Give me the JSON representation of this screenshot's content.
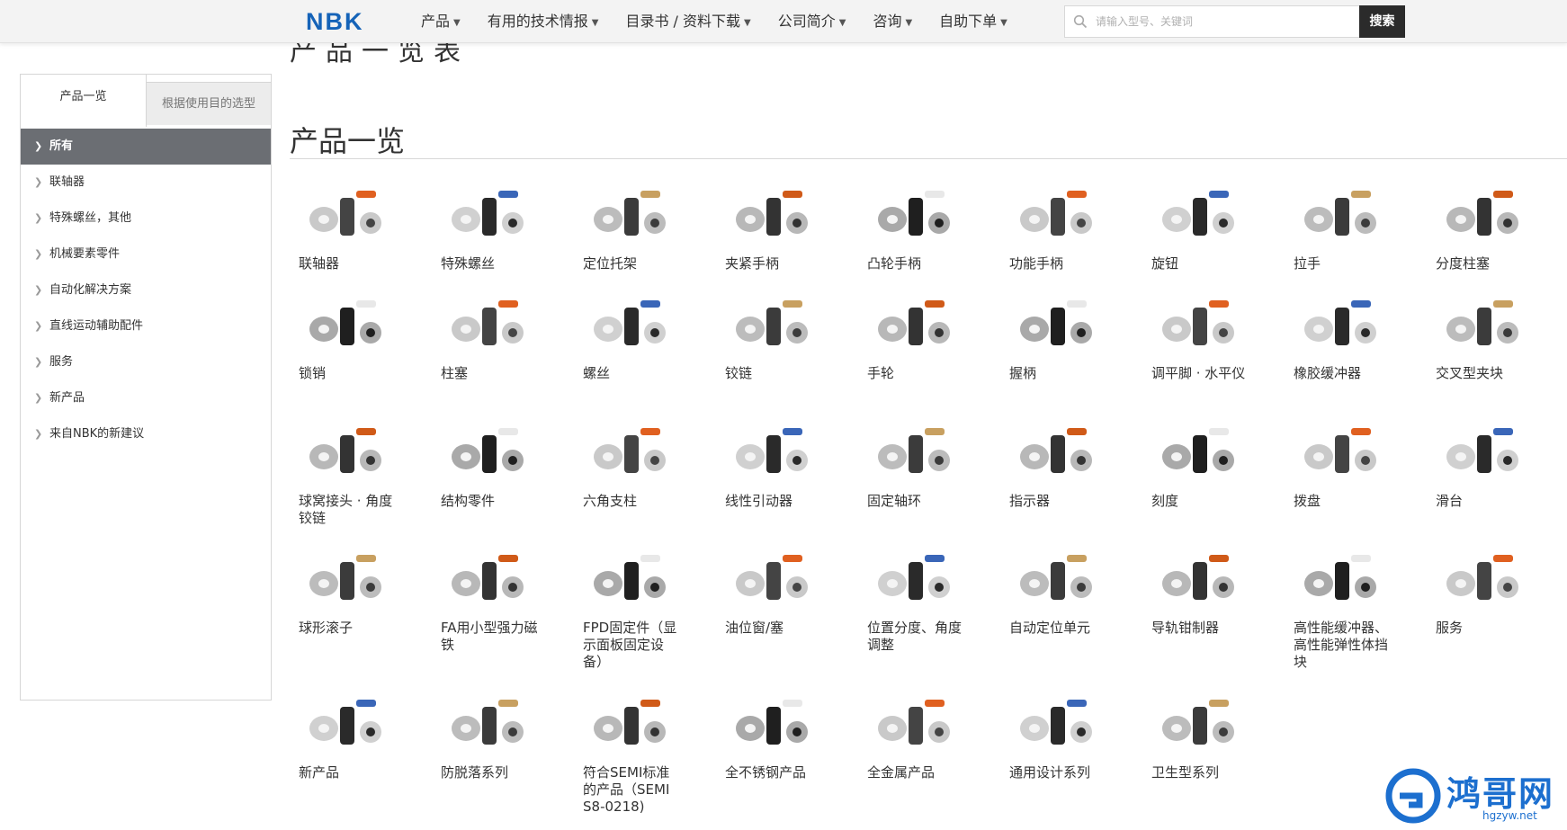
{
  "header": {
    "logo": "NBK",
    "nav": [
      {
        "label": "产品"
      },
      {
        "label": "有用的技术情报"
      },
      {
        "label": "目录书 / 资料下载"
      },
      {
        "label": "公司简介"
      },
      {
        "label": "咨询"
      },
      {
        "label": "自助下单"
      }
    ],
    "search_placeholder": "请输入型号、关键词",
    "search_button": "搜索"
  },
  "ghost_title": "产品一览表",
  "sidebar": {
    "tabs": [
      {
        "label": "产品一览",
        "active": true
      },
      {
        "label": "根据使用目的选型",
        "active": false
      }
    ],
    "items": [
      {
        "label": "所有",
        "active": true
      },
      {
        "label": "联轴器"
      },
      {
        "label": "特殊螺丝，其他"
      },
      {
        "label": "机械要素零件"
      },
      {
        "label": "自动化解决方案"
      },
      {
        "label": "直线运动辅助配件"
      },
      {
        "label": "服务"
      },
      {
        "label": "新产品"
      },
      {
        "label": "来自NBK的新建议"
      }
    ]
  },
  "main": {
    "title": "产品一览",
    "products": [
      {
        "label": "联轴器",
        "icon": "coupling-icon"
      },
      {
        "label": "特殊螺丝",
        "icon": "screw-icon"
      },
      {
        "label": "定位托架",
        "icon": "bracket-icon"
      },
      {
        "label": "夹紧手柄",
        "icon": "clamp-lever-icon"
      },
      {
        "label": "凸轮手柄",
        "icon": "cam-lever-icon"
      },
      {
        "label": "功能手柄",
        "icon": "function-handle-icon"
      },
      {
        "label": "旋钮",
        "icon": "knob-icon"
      },
      {
        "label": "拉手",
        "icon": "pull-handle-icon"
      },
      {
        "label": "分度柱塞",
        "icon": "indexing-plunger-icon"
      },
      {
        "label": "锁销",
        "icon": "lock-pin-icon"
      },
      {
        "label": "柱塞",
        "icon": "plunger-icon"
      },
      {
        "label": "螺丝",
        "icon": "bolt-icon"
      },
      {
        "label": "铰链",
        "icon": "hinge-icon"
      },
      {
        "label": "手轮",
        "icon": "handwheel-icon"
      },
      {
        "label": "握柄",
        "icon": "grip-icon"
      },
      {
        "label": "调平脚 · 水平仪",
        "icon": "leveling-foot-icon"
      },
      {
        "label": "橡胶缓冲器",
        "icon": "rubber-bumper-icon"
      },
      {
        "label": "交叉型夹块",
        "icon": "cross-clamp-icon"
      },
      {
        "label": "球窝接头 · 角度铰链",
        "icon": "ball-joint-icon"
      },
      {
        "label": "结构零件",
        "icon": "structure-part-icon"
      },
      {
        "label": "六角支柱",
        "icon": "hex-standoff-icon"
      },
      {
        "label": "线性引动器",
        "icon": "linear-actuator-icon"
      },
      {
        "label": "固定轴环",
        "icon": "shaft-collar-icon"
      },
      {
        "label": "指示器",
        "icon": "indicator-icon"
      },
      {
        "label": "刻度",
        "icon": "scale-icon"
      },
      {
        "label": "拨盘",
        "icon": "dial-icon"
      },
      {
        "label": "滑台",
        "icon": "slide-table-icon"
      },
      {
        "label": "球形滚子",
        "icon": "ball-roller-icon"
      },
      {
        "label": "FA用小型强力磁铁",
        "icon": "magnet-icon"
      },
      {
        "label": "FPD固定件（显示面板固定设备）",
        "icon": "fpd-fixture-icon"
      },
      {
        "label": "油位窗/塞",
        "icon": "oil-gauge-icon"
      },
      {
        "label": "位置分度、角度调整",
        "icon": "position-index-icon"
      },
      {
        "label": "自动定位单元",
        "icon": "auto-position-unit-icon"
      },
      {
        "label": "导轨钳制器",
        "icon": "rail-clamp-icon"
      },
      {
        "label": "高性能缓冲器、高性能弹性体挡块",
        "icon": "shock-absorber-icon"
      },
      {
        "label": "服务",
        "icon": "service-mascot-icon"
      },
      {
        "label": "新产品",
        "icon": "new-products-icon"
      },
      {
        "label": "防脱落系列",
        "icon": "anti-drop-icon"
      },
      {
        "label": "符合SEMI标准的产品（SEMI S8-0218)",
        "icon": "semi-standard-icon"
      },
      {
        "label": "全不锈钢产品",
        "icon": "stainless-icon"
      },
      {
        "label": "全金属产品",
        "icon": "all-metal-icon"
      },
      {
        "label": "通用设计系列",
        "icon": "universal-design-icon"
      },
      {
        "label": "卫生型系列",
        "icon": "hygienic-icon"
      }
    ]
  },
  "watermark": {
    "text": "鸿哥网",
    "sub": "hgzyw.net"
  },
  "colors": {
    "accent": "#1563b8",
    "sidebar_active": "#6b6e73",
    "search_button": "#2b2b2b"
  }
}
